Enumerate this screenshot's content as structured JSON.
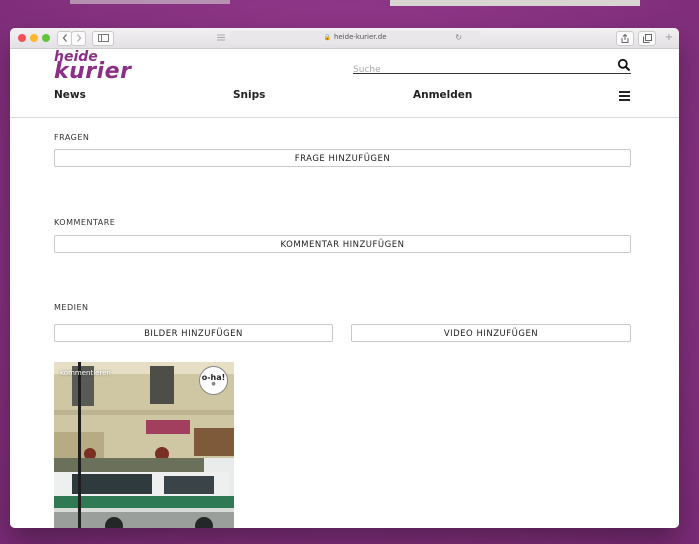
{
  "browser": {
    "url": "heide-kurier.de",
    "back_icon": "chevron-left",
    "forward_icon": "chevron-right"
  },
  "site": {
    "logo_top": "heide",
    "logo_bottom": "kurier",
    "brand_color": "#8b2f87",
    "search_placeholder": "Suche"
  },
  "nav": {
    "news": "News",
    "snips": "Snips",
    "login": "Anmelden"
  },
  "sections": {
    "fragen_label": "FRAGEN",
    "frage_button": "FRAGE HINZUFÜGEN",
    "kommentare_label": "KOMMENTARE",
    "kommentar_button": "KOMMENTAR HINZUFÜGEN",
    "medien_label": "MEDIEN",
    "bilder_button": "BILDER HINZUFÜGEN",
    "video_button": "VIDEO HINZUFÜGEN"
  },
  "media": {
    "caption": "kommentieren",
    "badge": "o-ha!"
  }
}
